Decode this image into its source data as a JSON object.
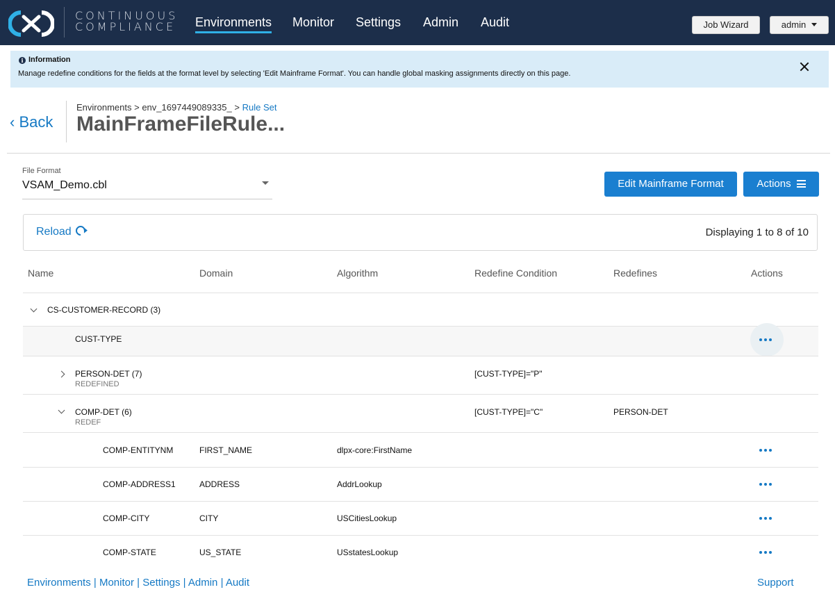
{
  "brand": {
    "line1": "CONTINUOUS",
    "line2": "COMPLIANCE"
  },
  "nav": {
    "items": [
      {
        "label": "Environments",
        "active": true
      },
      {
        "label": "Monitor"
      },
      {
        "label": "Settings"
      },
      {
        "label": "Admin"
      },
      {
        "label": "Audit"
      }
    ],
    "job_wizard": "Job Wizard",
    "user": "admin"
  },
  "banner": {
    "title": "Information",
    "text": "Manage redefine conditions for the fields at the format level by selecting 'Edit Mainframe Format'. You can handle global masking assignments directly on this page."
  },
  "header": {
    "back": "‹ Back",
    "breadcrumb": {
      "root": "Environments",
      "sep": ">",
      "env": "env_1697449089335_",
      "current": "Rule Set"
    },
    "title": "MainFrameFileRule..."
  },
  "file_format": {
    "label": "File Format",
    "value": "VSAM_Demo.cbl"
  },
  "buttons": {
    "edit_format": "Edit Mainframe Format",
    "actions": "Actions"
  },
  "toolbar": {
    "reload": "Reload",
    "displaying": "Displaying 1 to 8 of 10"
  },
  "table": {
    "columns": [
      "Name",
      "Domain",
      "Algorithm",
      "Redefine Condition",
      "Redefines",
      "Actions"
    ],
    "rows": [
      {
        "name": "CS-CUSTOMER-RECORD (3)",
        "expander": "down"
      },
      {
        "name": "CUST-TYPE",
        "actions": true
      },
      {
        "name": "PERSON-DET (7)",
        "sub": "REDEFINED",
        "condition": "[CUST-TYPE]=\"P\"",
        "expander": "right"
      },
      {
        "name": "COMP-DET (6)",
        "sub": "REDEF",
        "condition": "[CUST-TYPE]=\"C\"",
        "redefines": "PERSON-DET",
        "expander": "down"
      },
      {
        "name": "COMP-ENTITYNM",
        "domain": "FIRST_NAME",
        "algorithm": "dlpx-core:FirstName",
        "actions": true
      },
      {
        "name": "COMP-ADDRESS1",
        "domain": "ADDRESS",
        "algorithm": "AddrLookup",
        "actions": true
      },
      {
        "name": "COMP-CITY",
        "domain": "CITY",
        "algorithm": "USCitiesLookup",
        "actions": true
      },
      {
        "name": "COMP-STATE",
        "domain": "US_STATE",
        "algorithm": "USstatesLookup",
        "actions": true
      }
    ]
  },
  "footer": {
    "links": [
      "Environments",
      "Monitor",
      "Settings",
      "Admin",
      "Audit"
    ],
    "sep": "|",
    "support": "Support"
  },
  "colors": {
    "nav_bg": "#1c2e4a",
    "accent": "#1a7fd0",
    "banner_bg": "#d9ecf8",
    "link": "#1579c4"
  }
}
